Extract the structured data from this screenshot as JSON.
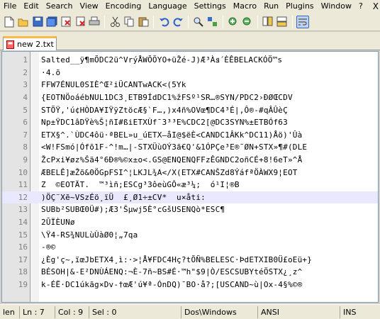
{
  "menu": {
    "items": [
      "File",
      "Edit",
      "Search",
      "View",
      "Encoding",
      "Language",
      "Settings",
      "Macro",
      "Run",
      "Plugins",
      "Window",
      "?"
    ],
    "close_glyph": "X"
  },
  "toolbar": {
    "icons": [
      "new-file-icon",
      "open-file-icon",
      "save-icon",
      "save-all-icon",
      "close-icon",
      "close-all-icon",
      "print-icon",
      "cut-icon",
      "copy-icon",
      "paste-icon",
      "undo-icon",
      "redo-icon",
      "find-icon",
      "replace-icon",
      "zoom-in-icon",
      "zoom-out-icon",
      "sync-vertical-icon",
      "sync-horizontal-icon",
      "word-wrap-icon"
    ]
  },
  "tabs": [
    {
      "label": "new  2.txt"
    }
  ],
  "editor": {
    "current_line": 12,
    "lines": [
      {
        "n": "1",
        "text": "Salted__ÿ¶mÕDC2ü^VrýÅWÕÖYO+üŽé-J)Æ³Àܦ´ÈÊBELACKÓÖ™s"
      },
      {
        "n": "2",
        "text": "·4.õ"
      },
      {
        "n": "3",
        "text": "FFW7ÉNUL0SIÈ^Œ²iÜCANTwACK<(5Yk"
      },
      {
        "n": "4",
        "text": "{EOTNÖoáébNUL1DC3¸ETB9ÍdDC1%žFSº¹SR…®SYN/PDC2›ÐØŒCDV"
      },
      {
        "n": "5",
        "text": "STÕŸ,'ú¢HÒDA¥IŸÿZtöcÆ§`F…,)x4ñ%OVœ¶DC4³É|,Ô®-#qÂÛèÇ"
      },
      {
        "n": "6",
        "text": "Np±ŸDC1âDŸè%Š¦ñI#ßiETXÙf¯3³³E%CDC2[@DC3SYN%±ETBÓf63"
      },
      {
        "n": "7",
        "text": "ETX§^.`ÙDC4ôü·ªBEL»u_úETX–åI@$ëÈ<CANDC1ÂKk^DC11)Åö)'Ûà"
      },
      {
        "n": "8",
        "text": "<W!FSmó|Ófõ1F-^!m…|-STXÜùOÝ3ã€Q'&1ÓPÇe³E®¯ØN+STX»¶#(DLE"
      },
      {
        "n": "9",
        "text": "ŽcPxi¥øz%Šä4°6Ð®%©x±o<.GS@ENQENQFFzÊGNDC2oñCÉ+8!6eT»^Å"
      },
      {
        "n": "10",
        "text": "ÆBELÊ]æŽõ&0ÖGpFSI^¦LKJL¾A</X(ETX#CANŠZd8ÝáfªÖÀWX9¦EOT"
      },
      {
        "n": "11",
        "text": "Z  ©EOTÄT.  ™³ìñ;ESCg³3ôeùGÔ«æ³¼;  ó¹I¦®B"
      },
      {
        "n": "12",
        "text": ")ÖÇ¨Xẽ~VSzÉö¸ïÜ  £¸Ø1÷±CV*  u×åti:"
      },
      {
        "n": "13",
        "text": "SUBb²SUBŒ0Ü#);Æ3'Šµwj5È°cGšUSENQò*ESC¶"
      },
      {
        "n": "14",
        "text": "2ŪÏÈUNø"
      },
      {
        "n": "15",
        "text": "\\Ÿ4-RS¾NULùÙàØ0¦„7qa"
      },
      {
        "n": "16",
        "text": "-®©"
      },
      {
        "n": "17",
        "text": "¿Èg'ç~,ïœJbETX4¸ì:·>¦Å¥FDC4Hç?tÕÑ%BELESC·ÞdETXIB0Ü£oEü+}"
      },
      {
        "n": "18",
        "text": "BÉSOH|&-E²DNÙÁENQ:¬È-7ñ~BS#É·™h\"$9|Ò/ESCSUBYtéÖSTX¿¸z^"
      },
      {
        "n": "19",
        "text": "k-ÉË·DC1úkãg×Dv-†œÆ'ú¥ª-ÓnDQ)¯BO·å?;[USCAND~ù|Ox-4§%©®"
      }
    ]
  },
  "status": {
    "length": "len",
    "ln": "Ln : 7",
    "col": "Col : 9",
    "sel": "Sel : 0",
    "eol": "Dos\\Windows",
    "encoding": "ANSI",
    "mode": "INS"
  }
}
